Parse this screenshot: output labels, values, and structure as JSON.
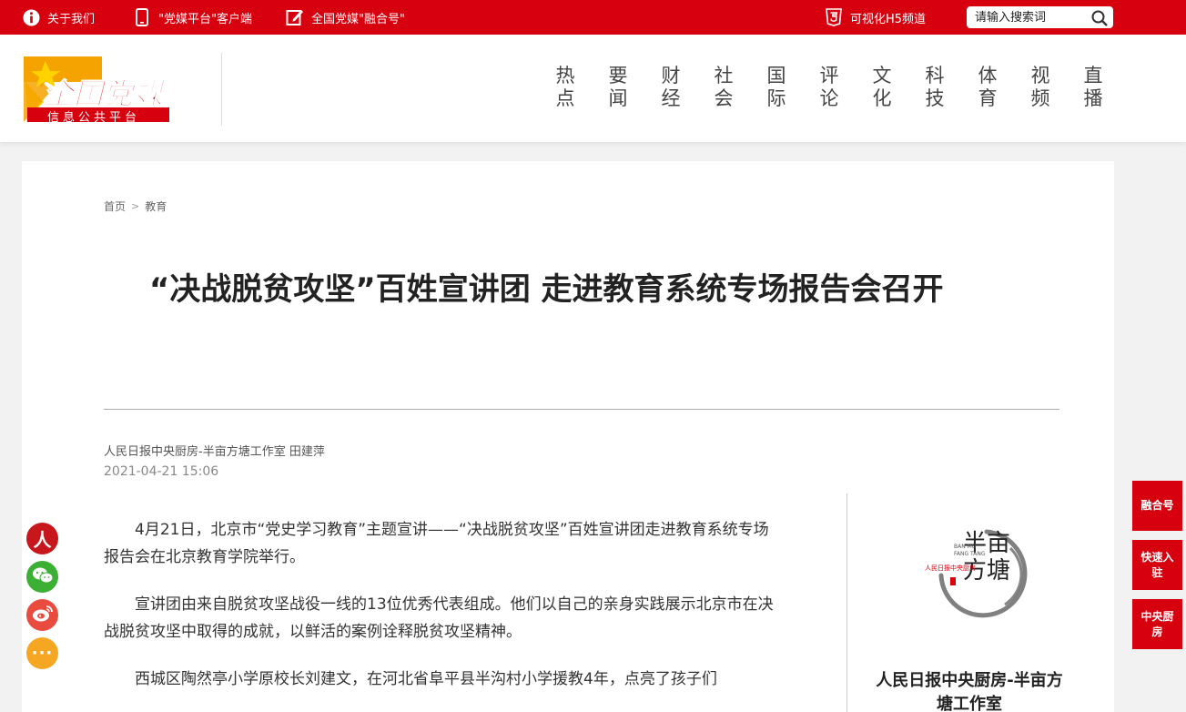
{
  "topbar": {
    "about": "关于我们",
    "client": "\"党媒平台\"客户端",
    "fusion": "全国党媒\"融合号\"",
    "h5": "可视化H5频道",
    "search_placeholder": "请输入搜索词",
    "brand_color": "#d7000f"
  },
  "logo": {
    "main": "全国党媒",
    "sub": "信息公共平台"
  },
  "nav": [
    "热点",
    "要闻",
    "财经",
    "社会",
    "国际",
    "评论",
    "文化",
    "科技",
    "体育",
    "视频",
    "直播"
  ],
  "breadcrumb": {
    "home": "首页",
    "separator": ">",
    "current": "教育"
  },
  "article": {
    "title": "“决战脱贫攻坚”百姓宣讲团 走进教育系统专场报告会召开",
    "author": "人民日报中央厨房-半亩方塘工作室 田建萍",
    "date": "2021-04-21 15:06",
    "paragraphs": [
      "4月21日，北京市“党史学习教育”主题宣讲——“决战脱贫攻坚”百姓宣讲团走进教育系统专场报告会在北京教育学院举行。",
      "宣讲团由来自脱贫攻坚战役一线的13位优秀代表组成。他们以自己的亲身实践展示北京市在决战脱贫攻坚中取得的成就，以鲜活的案例诠释脱贫攻坚精神。",
      "西城区陶然亭小学原校长刘建文，在河北省阜平县半沟村小学援教4年，点亮了孩子们"
    ]
  },
  "sidebar": {
    "logo_big": "半亩方塘",
    "logo_pinyin_1": "BAN MU",
    "logo_pinyin_2": "FANG TANG",
    "logo_small": "人民日报中央厨房",
    "name": "人民日报中央厨房-半亩方塘工作室"
  },
  "share": {
    "people_glyph": "人",
    "more_glyph": "···"
  },
  "float": {
    "fusion": "融合号",
    "quick_join": "快速入驻",
    "kitchen": "中央厨房"
  }
}
